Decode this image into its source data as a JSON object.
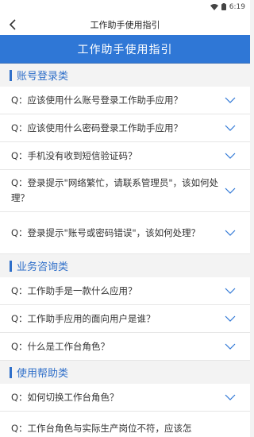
{
  "status_bar": {
    "time": "6:19"
  },
  "header": {
    "title": "工作助手使用指引"
  },
  "banner": {
    "title": "工作助手使用指引"
  },
  "sections": [
    {
      "title": "账号登录类",
      "items": [
        "Q：应该使用什么账号登录工作助手应用？",
        "Q：应该使用什么密码登录工作助手应用？",
        "Q：手机没有收到短信验证码？",
        "Q：登录提示\"网络繁忙，请联系管理员\"，该如何处理？",
        "Q：登录提示\"账号或密码错误\"，该如何处理？"
      ]
    },
    {
      "title": "业务咨询类",
      "items": [
        "Q：工作助手是一款什么应用？",
        "Q：工作助手应用的面向用户是谁？",
        "Q：什么是工作台角色？"
      ]
    },
    {
      "title": "使用帮助类",
      "items": [
        "Q：如何切换工作台角色？",
        "Q：工作台角色与实际生产岗位不符，应该怎"
      ]
    }
  ],
  "colors": {
    "accent": "#2f6fc9",
    "banner_bg": "#2f77d6"
  },
  "icons": {
    "back": "chevron-left-icon",
    "expand": "chevron-down-icon",
    "wifi": "wifi-icon",
    "battery": "battery-icon"
  }
}
